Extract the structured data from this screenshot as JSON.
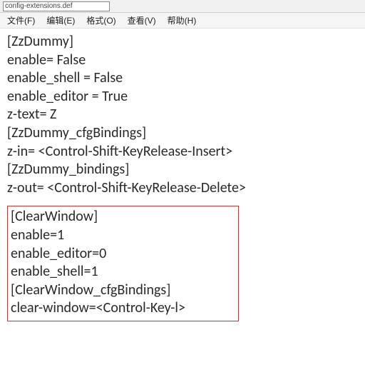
{
  "titlebar": {
    "filename": "config-extensions.def"
  },
  "menu": {
    "file": "文件(F)",
    "edit": "编辑(E)",
    "format": "格式(O)",
    "view": "查看(V)",
    "help": "帮助(H)"
  },
  "block1": {
    "l1": "[ZzDummy]",
    "l2": "enable= False",
    "l3": "enable_shell = False",
    "l4": "enable_editor = True",
    "l5": "z-text= Z",
    "l6": "[ZzDummy_cfgBindings]",
    "l7": "z-in= <Control-Shift-KeyRelease-Insert>",
    "l8": "[ZzDummy_bindings]",
    "l9": "z-out= <Control-Shift-KeyRelease-Delete>"
  },
  "block2": {
    "l1": "[ClearWindow]",
    "l2": "enable=1",
    "l3": "enable_editor=0",
    "l4": "enable_shell=1",
    "l5": "[ClearWindow_cfgBindings]",
    "l6": "clear-window=<Control-Key-l>"
  }
}
